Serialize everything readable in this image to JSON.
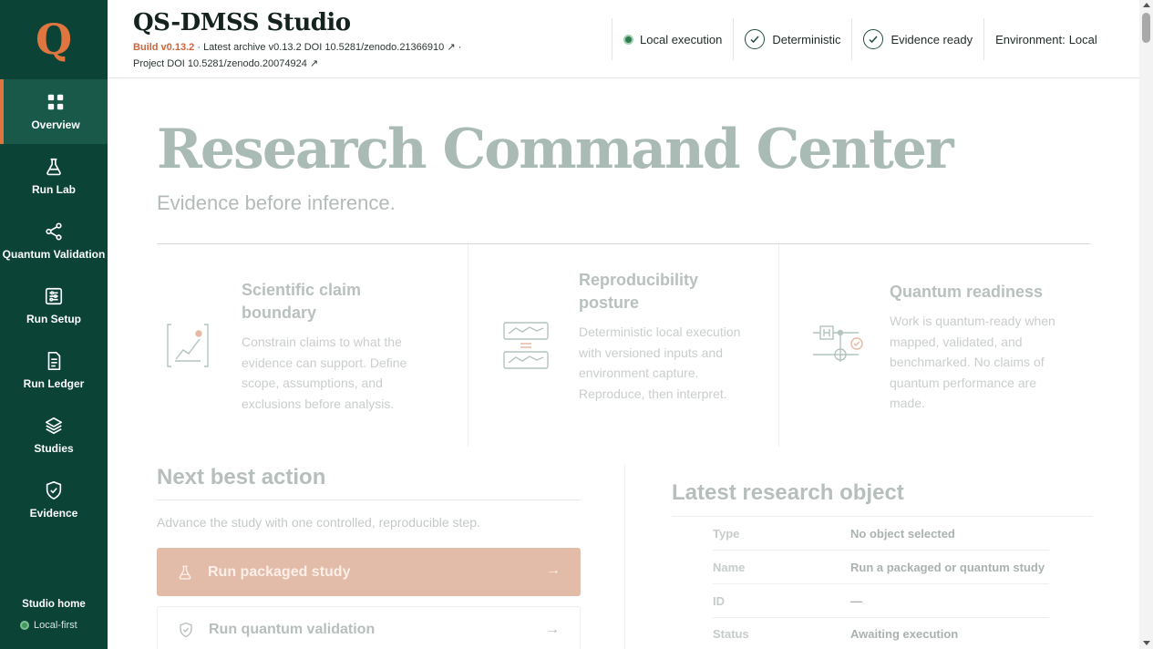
{
  "sidebar": {
    "logo": "Q",
    "items": [
      {
        "label": "Overview",
        "icon": "grid-icon"
      },
      {
        "label": "Run Lab",
        "icon": "flask-icon"
      },
      {
        "label": "Quantum Validation",
        "icon": "share-nodes-icon"
      },
      {
        "label": "Run Setup",
        "icon": "sliders-icon"
      },
      {
        "label": "Run Ledger",
        "icon": "document-icon"
      },
      {
        "label": "Studies",
        "icon": "layers-icon"
      },
      {
        "label": "Evidence",
        "icon": "shield-check-icon"
      }
    ],
    "active": "Overview",
    "footer_title": "Studio home",
    "footer_status": "Local-first"
  },
  "header": {
    "title": "QS-DMSS Studio",
    "build": "Build v0.13.2",
    "separator": "·",
    "archive": "Latest archive v0.13.2 DOI 10.5281/zenodo.21366910",
    "project": "Project DOI 10.5281/zenodo.20074924",
    "external_link_glyph": "↗",
    "status": {
      "local_execution": "Local execution",
      "deterministic": "Deterministic",
      "evidence_ready": "Evidence ready",
      "environment_label": "Environment:",
      "environment_value": "Local"
    }
  },
  "hero": {
    "title": "Research Command Center",
    "subtitle": "Evidence before inference."
  },
  "cards": [
    {
      "title": "Scientific claim boundary",
      "text": "Constrain claims to what the evidence can support. Define scope, assumptions, and exclusions before analysis.",
      "icon": "chart-boundary-icon"
    },
    {
      "title": "Reproducibility posture",
      "text": "Deterministic local execution with versioned inputs and environment capture. Reproduce, then interpret.",
      "icon": "reproducibility-icon"
    },
    {
      "title": "Quantum readiness",
      "text": "Work is quantum-ready when mapped, validated, and benchmarked. No claims of quantum performance are made.",
      "icon": "quantum-circuit-icon"
    }
  ],
  "next_best_action": {
    "title": "Next best action",
    "subtitle": "Advance the study with one controlled, reproducible step.",
    "primary": "Run packaged study",
    "secondary": "Run quantum validation",
    "arrow": "→"
  },
  "latest_research_object": {
    "title": "Latest research object",
    "rows": [
      {
        "key": "Type",
        "value": "No object selected"
      },
      {
        "key": "Name",
        "value": "Run a packaged or quantum study"
      },
      {
        "key": "ID",
        "value": "—"
      },
      {
        "key": "Status",
        "value": "Awaiting execution"
      }
    ]
  },
  "colors": {
    "sidebar_bg": "#0b4337",
    "accent": "#e0763f",
    "primary_button": "#e3bca9"
  }
}
